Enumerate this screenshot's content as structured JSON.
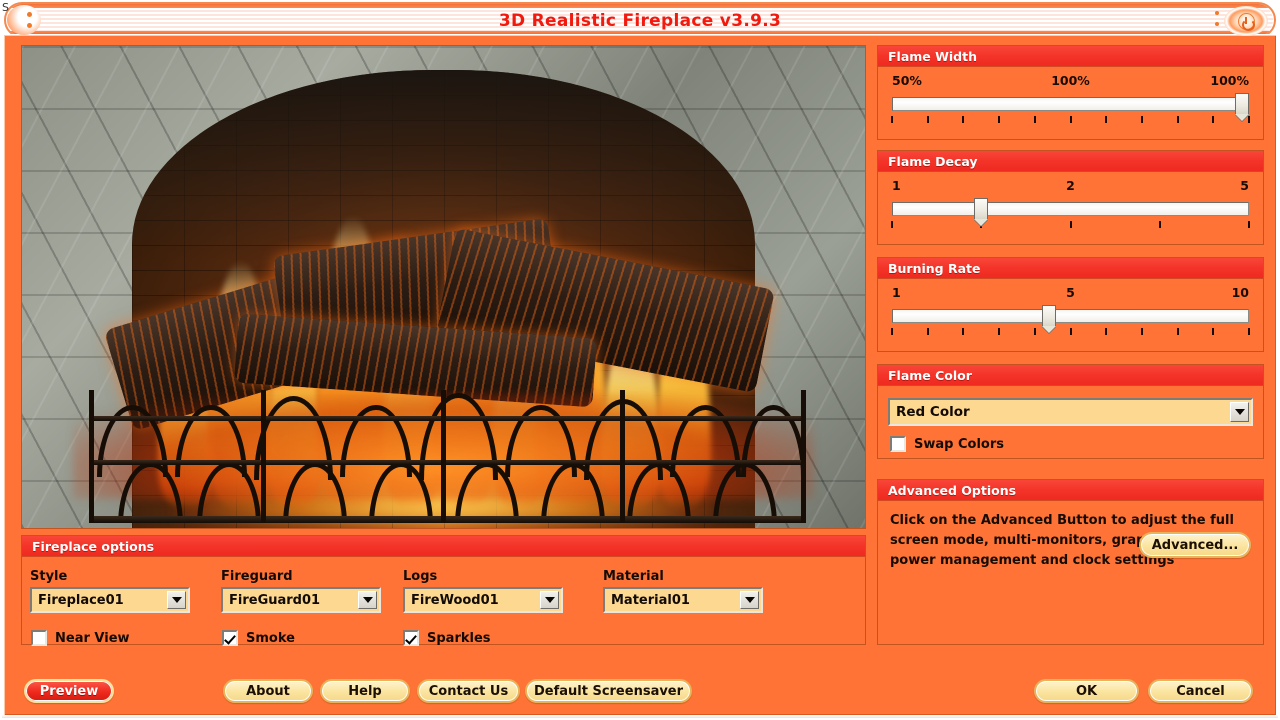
{
  "window": {
    "title": "3D Realistic Fireplace v3.9.3",
    "stray_glyph": "S",
    "power_icon": "power-icon"
  },
  "preview": {
    "alt": "3D realistic fireplace preview with stone arch, burning logs and iron fireguard"
  },
  "sliders": [
    {
      "title": "Flame Width",
      "min_label": "50%",
      "mid_label": "100%",
      "max_label": "100%",
      "value_percent": 100,
      "tick_count": 11
    },
    {
      "title": "Flame Decay",
      "min_label": "1",
      "mid_label": "2",
      "max_label": "5",
      "value_percent": 25,
      "tick_count": 5
    },
    {
      "title": "Burning Rate",
      "min_label": "1",
      "mid_label": "5",
      "max_label": "10",
      "value_percent": 44,
      "tick_count": 11
    }
  ],
  "flame_color": {
    "title": "Flame Color",
    "selected": "Red Color",
    "swap_colors_label": "Swap Colors",
    "swap_colors_checked": false
  },
  "advanced": {
    "title": "Advanced Options",
    "description": "Click on the Advanced Button to adjust the full screen mode, multi-monitors, graphics, sound, power management and clock settings",
    "button_label": "Advanced..."
  },
  "fireplace_options": {
    "title": "Fireplace options",
    "fields": [
      {
        "label": "Style",
        "value": "Fireplace01"
      },
      {
        "label": "Fireguard",
        "value": "FireGuard01"
      },
      {
        "label": "Logs",
        "value": "FireWood01"
      },
      {
        "label": "Material",
        "value": "Material01"
      }
    ],
    "checkboxes": [
      {
        "label": "Near View",
        "checked": false
      },
      {
        "label": "Smoke",
        "checked": true
      },
      {
        "label": "Sparkles",
        "checked": true
      }
    ]
  },
  "footer": {
    "preview_label": "Preview",
    "about_label": "About",
    "help_label": "Help",
    "contact_label": "Contact Us",
    "default_screensaver_label": "Default Screensaver",
    "ok_label": "OK",
    "cancel_label": "Cancel"
  },
  "colors": {
    "body_orange": "#ff7436",
    "panel_header_red": "#f0291d",
    "title_text_red": "#f2190f",
    "combo_yellow": "#fcd891",
    "pill_yellow": "#fbe6a4"
  }
}
